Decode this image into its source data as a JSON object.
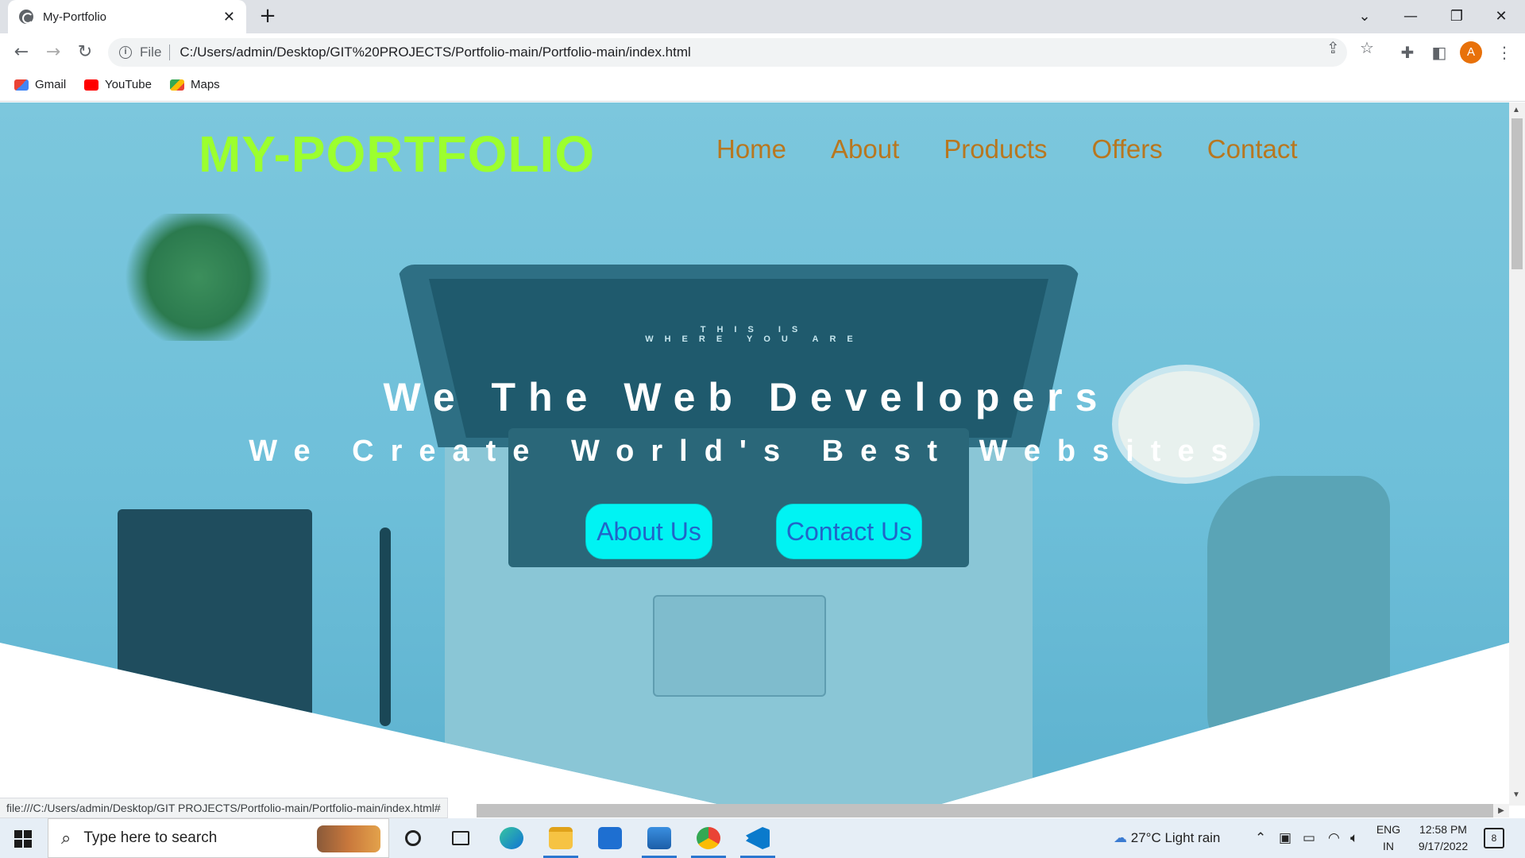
{
  "browser": {
    "tab_title": "My-Portfolio",
    "tab_close": "✕",
    "new_tab": "+",
    "scheme_label": "File",
    "url": "C:/Users/admin/Desktop/GIT%20PROJECTS/Portfolio-main/Portfolio-main/index.html",
    "avatar_letter": "A",
    "bookmarks": [
      "Gmail",
      "YouTube",
      "Maps"
    ],
    "status_url": "file:///C:/Users/admin/Desktop/GIT PROJECTS/Portfolio-main/Portfolio-main/index.html#"
  },
  "site": {
    "logo": "MY-PORTFOLIO",
    "nav": [
      "Home",
      "About",
      "Products",
      "Offers",
      "Contact"
    ],
    "headline": "We The Web Developers",
    "subline": "We Create World's Best Websites",
    "buttons": {
      "about": "About Us",
      "contact": "Contact Us"
    },
    "laptop_screen_text": [
      "THIS IS",
      "WHERE YOU ARE"
    ],
    "colors": {
      "logo": "#9cff2e",
      "nav": "#b8771f",
      "button_bg": "#00f3f3",
      "button_text": "#2165c8",
      "hero_overlay": "#6ebfd9"
    }
  },
  "taskbar": {
    "search_placeholder": "Type here to search",
    "weather": "27°C  Light rain",
    "lang_top": "ENG",
    "lang_bottom": "IN",
    "time": "12:58 PM",
    "date": "9/17/2022",
    "notification_count": "8",
    "apps": [
      "cortana-icon",
      "task-view-icon",
      "edge-icon",
      "file-explorer-icon",
      "mail-icon",
      "photos-icon",
      "chrome-icon",
      "vscode-icon"
    ]
  }
}
